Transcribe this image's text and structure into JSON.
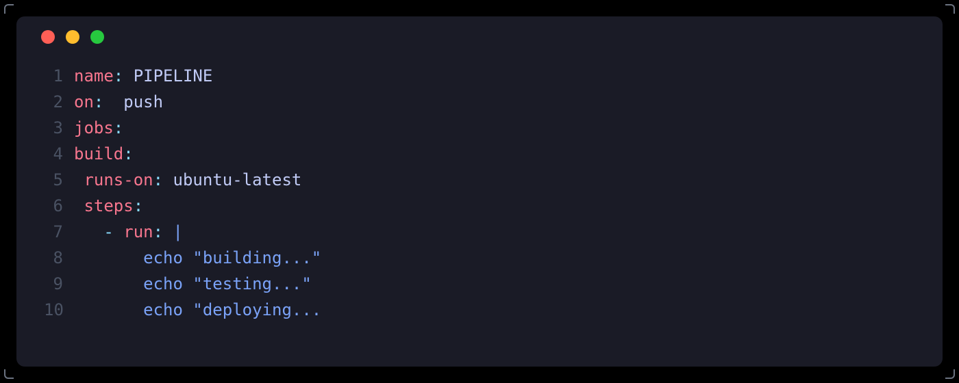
{
  "code": {
    "lines": [
      {
        "num": "1",
        "tokens": [
          {
            "cls": "tok-key",
            "text": "name"
          },
          {
            "cls": "tok-colon",
            "text": ":"
          },
          {
            "cls": "tok-plain",
            "text": " "
          },
          {
            "cls": "tok-value",
            "text": "PIPELINE"
          }
        ]
      },
      {
        "num": "2",
        "tokens": [
          {
            "cls": "tok-key",
            "text": "on"
          },
          {
            "cls": "tok-colon",
            "text": ":"
          },
          {
            "cls": "tok-plain",
            "text": "  "
          },
          {
            "cls": "tok-value",
            "text": "push"
          }
        ]
      },
      {
        "num": "3",
        "tokens": [
          {
            "cls": "tok-key",
            "text": "jobs"
          },
          {
            "cls": "tok-colon",
            "text": ":"
          }
        ]
      },
      {
        "num": "4",
        "tokens": [
          {
            "cls": "tok-key",
            "text": "build"
          },
          {
            "cls": "tok-colon",
            "text": ":"
          }
        ]
      },
      {
        "num": "5",
        "tokens": [
          {
            "cls": "tok-plain",
            "text": " "
          },
          {
            "cls": "tok-key",
            "text": "runs-on"
          },
          {
            "cls": "tok-colon",
            "text": ":"
          },
          {
            "cls": "tok-plain",
            "text": " "
          },
          {
            "cls": "tok-value",
            "text": "ubuntu-latest"
          }
        ]
      },
      {
        "num": "6",
        "tokens": [
          {
            "cls": "tok-plain",
            "text": " "
          },
          {
            "cls": "tok-key",
            "text": "steps"
          },
          {
            "cls": "tok-colon",
            "text": ":"
          }
        ]
      },
      {
        "num": "7",
        "tokens": [
          {
            "cls": "tok-plain",
            "text": "   "
          },
          {
            "cls": "tok-dash",
            "text": "-"
          },
          {
            "cls": "tok-plain",
            "text": " "
          },
          {
            "cls": "tok-key",
            "text": "run"
          },
          {
            "cls": "tok-colon",
            "text": ":"
          },
          {
            "cls": "tok-plain",
            "text": " "
          },
          {
            "cls": "tok-string",
            "text": "|"
          }
        ]
      },
      {
        "num": "8",
        "tokens": [
          {
            "cls": "tok-plain",
            "text": "       "
          },
          {
            "cls": "tok-string",
            "text": "echo \"building...\""
          }
        ]
      },
      {
        "num": "9",
        "tokens": [
          {
            "cls": "tok-plain",
            "text": "       "
          },
          {
            "cls": "tok-string",
            "text": "echo \"testing...\""
          }
        ]
      },
      {
        "num": "10",
        "tokens": [
          {
            "cls": "tok-plain",
            "text": "       "
          },
          {
            "cls": "tok-string",
            "text": "echo \"deploying..."
          }
        ]
      }
    ]
  }
}
